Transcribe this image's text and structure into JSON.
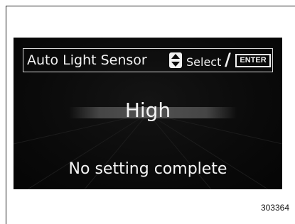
{
  "display": {
    "header": {
      "title": "Auto Light Sensor",
      "select_icon": "up-down-arrows-icon",
      "select_label": "Select",
      "separator": "/",
      "enter_label": "ENTER"
    },
    "current_value": "High",
    "status_message": "No setting complete"
  },
  "figure_id": "303364",
  "colors": {
    "screen_background": "#0a0a0a",
    "text": "#f2f2f2",
    "page_background": "#ffffff"
  }
}
